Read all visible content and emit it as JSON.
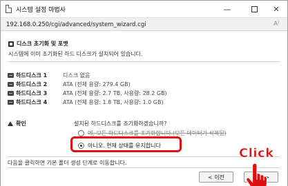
{
  "window": {
    "title": "시스템 설정 마법사",
    "controls": {
      "minimize": "—",
      "maximize": "",
      "close": "✕"
    }
  },
  "address_bar": {
    "url": "192.168.0.250/cgi/advanced/system_wizard.cgi",
    "reader_icon": "A⁾"
  },
  "section": {
    "icon": "square-icon",
    "title": "디스크 초기화 및 포맷",
    "intro": "시스템에 이미 초기화된 하드 디스크가 설치되어 있습니다."
  },
  "disks": [
    {
      "name": "하드디스크 1",
      "info": "디스크 없음"
    },
    {
      "name": "하드디스크 2",
      "info": "ATA (전체 용량: 279.4 GB)"
    },
    {
      "name": "하드디스크 3",
      "info": "ATA (전체 용량: 2.7 TB, 사용량: 28.2 GB)"
    },
    {
      "name": "하드디스크 4",
      "info": "ATA (전체 용량: 1.8 TB, 사용량: 1.0 GB)"
    }
  ],
  "confirm": {
    "label": "확인",
    "question": "설치된 하드디스크를 초기화하겠습니까?",
    "options": [
      {
        "label": "예, 모든 하드디스크를 초기화합니다.(모든 데이터가 삭제됨)",
        "selected": false
      },
      {
        "label": "아니오. 현재 상태를 유지합니다",
        "selected": true
      }
    ]
  },
  "footer_note": "다음을 클릭하면 기본 폴더 생성 단계로 이동합니다.",
  "buttons": {
    "prev": "< 이전",
    "next": "다음 >"
  },
  "annotation": {
    "click_label": "Click",
    "highlight_color": "#e01010"
  }
}
